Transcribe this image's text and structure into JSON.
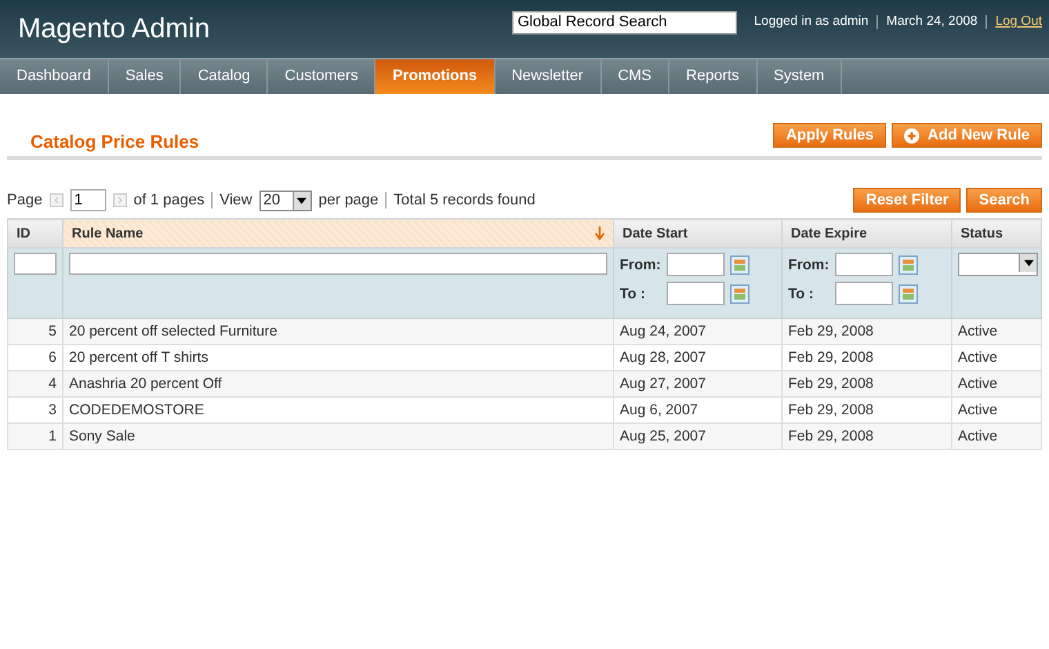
{
  "header": {
    "logo": "Magento Admin",
    "search": {
      "value": "Global Record Search"
    },
    "user": "Logged in as admin",
    "date": "March 24, 2008",
    "logout": "Log Out"
  },
  "nav": [
    {
      "label": "Dashboard",
      "selected": false
    },
    {
      "label": "Sales",
      "selected": false
    },
    {
      "label": "Catalog",
      "selected": false
    },
    {
      "label": "Customers",
      "selected": false
    },
    {
      "label": "Promotions",
      "selected": true
    },
    {
      "label": "Newsletter",
      "selected": false
    },
    {
      "label": "CMS",
      "selected": false
    },
    {
      "label": "Reports",
      "selected": false
    },
    {
      "label": "System",
      "selected": false
    }
  ],
  "page_title": "Catalog Price Rules",
  "actions": [
    {
      "label": "Apply Rules",
      "kind": "plain"
    },
    {
      "label": "Add New Rule",
      "kind": "add"
    }
  ],
  "pager": {
    "page_label": "Page",
    "page": "1",
    "of_pages": "of 1 pages",
    "view_label": "View",
    "per_page": "20",
    "per_page_label": "per page",
    "total": "Total 5 records found"
  },
  "grid_buttons": [
    "Reset Filter",
    "Search"
  ],
  "columns": [
    {
      "label": "ID",
      "sorted": false,
      "kind": "text"
    },
    {
      "label": "Rule Name",
      "sorted": true,
      "kind": "text"
    },
    {
      "label": "Date Start",
      "sorted": false,
      "kind": "date",
      "date_labels": [
        "From:",
        "To :"
      ]
    },
    {
      "label": "Date Expire",
      "sorted": false,
      "kind": "date",
      "date_labels": [
        "From:",
        "To :"
      ]
    },
    {
      "label": "Status",
      "sorted": false,
      "kind": "select"
    }
  ],
  "rows": [
    [
      "5",
      "20 percent off selected Furniture",
      "Aug 24, 2007",
      "Feb 29, 2008",
      "Active"
    ],
    [
      "6",
      "20 percent off T shirts",
      "Aug 28, 2007",
      "Feb 29, 2008",
      "Active"
    ],
    [
      "4",
      "Anashria 20 percent Off",
      "Aug 27, 2007",
      "Feb 29, 2008",
      "Active"
    ],
    [
      "3",
      "CODEDEMOSTORE",
      "Aug 6, 2007",
      "Feb 29, 2008",
      "Active"
    ],
    [
      "1",
      "Sony Sale",
      "Aug 25, 2007",
      "Feb 29, 2008",
      "Active"
    ]
  ]
}
